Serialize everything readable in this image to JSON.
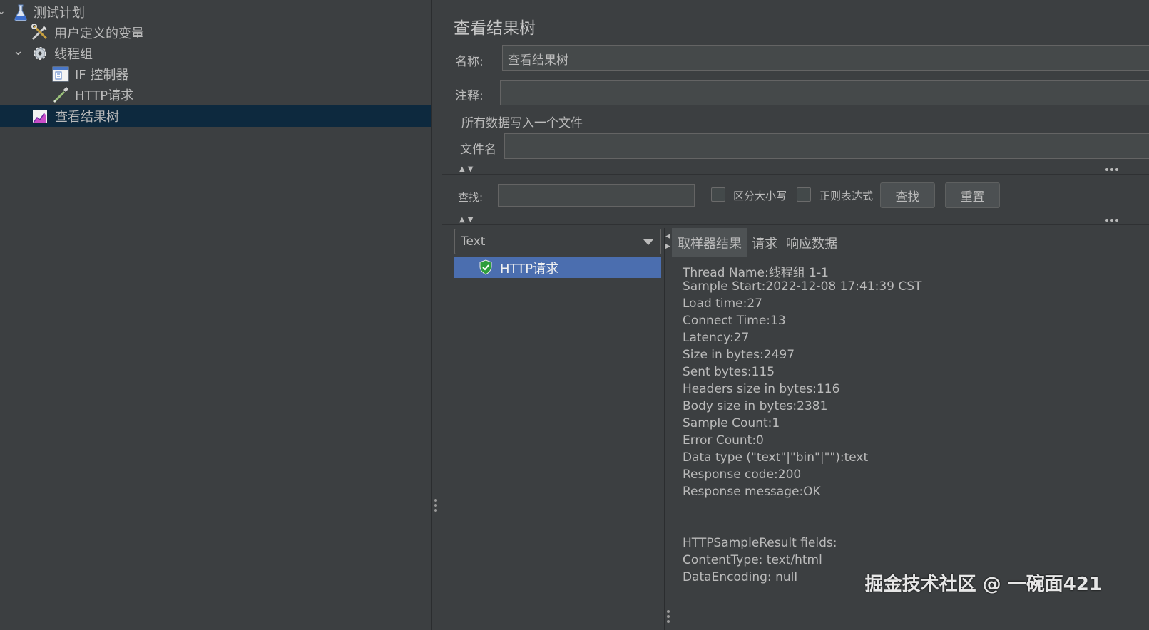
{
  "tree": {
    "items": [
      {
        "label": "测试计划",
        "icon": "flask-icon"
      },
      {
        "label": "用户定义的变量",
        "icon": "tools-icon"
      },
      {
        "label": "线程组",
        "icon": "gear-icon"
      },
      {
        "label": "IF 控制器",
        "icon": "if-controller-icon"
      },
      {
        "label": "HTTP请求",
        "icon": "pipette-icon"
      },
      {
        "label": "查看结果树",
        "icon": "chart-icon"
      }
    ]
  },
  "panel": {
    "title": "查看结果树",
    "name_label": "名称:",
    "name_value": "查看结果树",
    "comment_label": "注释:",
    "comment_value": "",
    "file_group_label": "所有数据写入一个文件",
    "filename_label": "文件名",
    "filename_value": ""
  },
  "search": {
    "label": "查找:",
    "value": "",
    "case_sensitive_label": "区分大小写",
    "regex_label": "正则表达式",
    "find_button": "查找",
    "reset_button": "重置"
  },
  "results": {
    "renderer_selected": "Text",
    "items": [
      {
        "label": "HTTP请求",
        "status": "success"
      }
    ]
  },
  "tabs": [
    "取样器结果",
    "请求",
    "响应数据"
  ],
  "sampler_result": {
    "lines": [
      "Thread Name:线程组 1-1",
      "Sample Start:2022-12-08 17:41:39 CST",
      "Load time:27",
      "Connect Time:13",
      "Latency:27",
      "Size in bytes:2497",
      "Sent bytes:115",
      "Headers size in bytes:116",
      "Body size in bytes:2381",
      "Sample Count:1",
      "Error Count:0",
      "Data type (\"text\"|\"bin\"|\"\"):text",
      "Response code:200",
      "Response message:OK"
    ],
    "fields_lines": [
      "HTTPSampleResult fields:",
      "ContentType: text/html",
      "DataEncoding: null"
    ]
  },
  "watermark": "掘金技术社区 @ 一碗面421",
  "colors": {
    "background": "#3c3f41",
    "tree_selected": "#0d293e",
    "result_selected": "#4b6eaf",
    "success_shield": "#2e9e3c"
  }
}
